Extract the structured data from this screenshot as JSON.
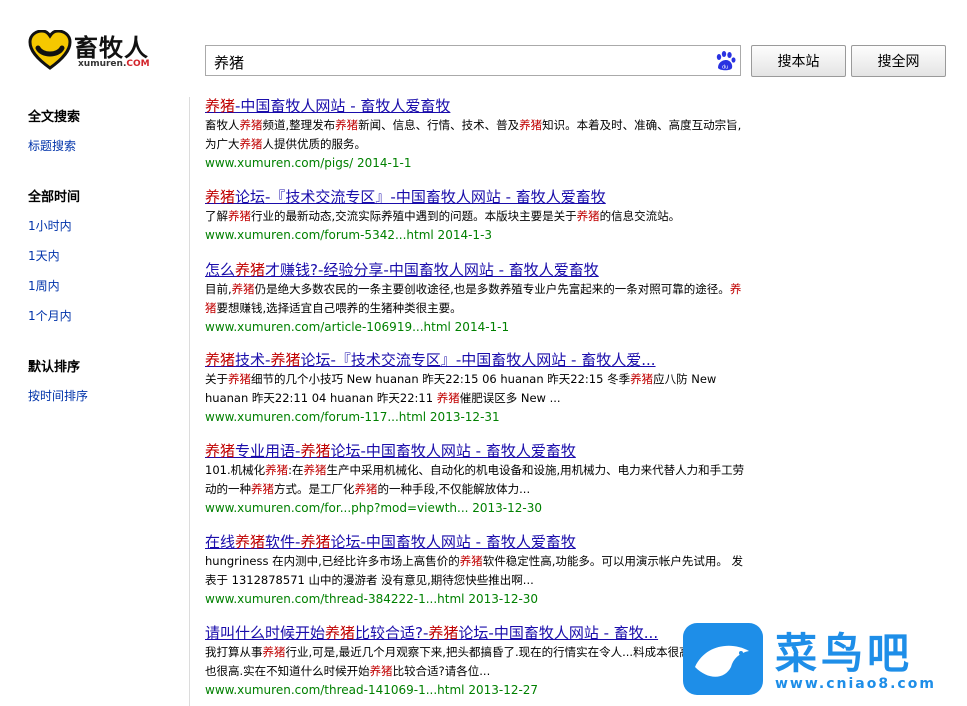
{
  "logo": {
    "name": "畜牧人",
    "sub_main": "xumuren.",
    "sub_com": "COM"
  },
  "search": {
    "query": "养猪",
    "btn_site": "搜本站",
    "btn_all": "搜全网"
  },
  "sidebar": {
    "search_type": {
      "heading": "全文搜索",
      "items": [
        "标题搜索"
      ]
    },
    "time": {
      "heading": "全部时间",
      "items": [
        "1小时内",
        "1天内",
        "1周内",
        "1个月内"
      ]
    },
    "sort": {
      "heading": "默认排序",
      "items": [
        "按时间排序"
      ]
    }
  },
  "results": [
    {
      "title": [
        [
          "养猪",
          true
        ],
        [
          "-中国畜牧人网站 - 畜牧人爱畜牧",
          false
        ]
      ],
      "snippet": [
        [
          "畜牧人",
          false
        ],
        [
          "养猪",
          true
        ],
        [
          "频道,整理发布",
          false
        ],
        [
          "养猪",
          true
        ],
        [
          "新闻、信息、行情、技术、普及",
          false
        ],
        [
          "养猪",
          true
        ],
        [
          "知识。本着及时、准确、高度互动宗旨,为广大",
          false
        ],
        [
          "养猪",
          true
        ],
        [
          "人提供优质的服务。",
          false
        ]
      ],
      "url": "www.xumuren.com/pigs/ 2014-1-1"
    },
    {
      "title": [
        [
          "养猪",
          true
        ],
        [
          "论坛-『技术交流专区』-中国畜牧人网站 - 畜牧人爱畜牧",
          false
        ]
      ],
      "snippet": [
        [
          "了解",
          false
        ],
        [
          "养猪",
          true
        ],
        [
          "行业的最新动态,交流实际养殖中遇到的问题。本版块主要是关于",
          false
        ],
        [
          "养猪",
          true
        ],
        [
          "的信息交流站。",
          false
        ]
      ],
      "url": "www.xumuren.com/forum-5342...html 2014-1-3"
    },
    {
      "title": [
        [
          "怎么",
          false
        ],
        [
          "养猪",
          true
        ],
        [
          "才赚钱?-经验分享-中国畜牧人网站 - 畜牧人爱畜牧",
          false
        ]
      ],
      "snippet": [
        [
          "目前,",
          false
        ],
        [
          "养猪",
          true
        ],
        [
          "仍是绝大多数农民的一条主要创收途径,也是多数养殖专业户先富起来的一条对照可靠的途径。",
          false
        ],
        [
          "养猪",
          true
        ],
        [
          "要想赚钱,选择适宜自己喂养的生猪种类很主要。",
          false
        ]
      ],
      "url": "www.xumuren.com/article-106919...html 2014-1-1"
    },
    {
      "title": [
        [
          "养猪",
          true
        ],
        [
          "技术-",
          false
        ],
        [
          "养猪",
          true
        ],
        [
          "论坛-『技术交流专区』-中国畜牧人网站 - 畜牧人爱...",
          false
        ]
      ],
      "snippet": [
        [
          "关于",
          false
        ],
        [
          "养猪",
          true
        ],
        [
          "细节的几个小技巧 New huanan 昨天22:15 06 huanan 昨天22:15 冬季",
          false
        ],
        [
          "养猪",
          true
        ],
        [
          "应八防 New huanan 昨天22:11 04 huanan 昨天22:11 ",
          false
        ],
        [
          "养猪",
          true
        ],
        [
          "催肥误区多 New ...",
          false
        ]
      ],
      "url": "www.xumuren.com/forum-117...html 2013-12-31"
    },
    {
      "title": [
        [
          "养猪",
          true
        ],
        [
          "专业用语-",
          false
        ],
        [
          "养猪",
          true
        ],
        [
          "论坛-中国畜牧人网站 - 畜牧人爱畜牧",
          false
        ]
      ],
      "snippet": [
        [
          "101.机械化",
          false
        ],
        [
          "养猪",
          true
        ],
        [
          ":在",
          false
        ],
        [
          "养猪",
          true
        ],
        [
          "生产中采用机械化、自动化的机电设备和设施,用机械力、电力来代替人力和手工劳动的一种",
          false
        ],
        [
          "养猪",
          true
        ],
        [
          "方式。是工厂化",
          false
        ],
        [
          "养猪",
          true
        ],
        [
          "的一种手段,不仅能解放体力...",
          false
        ]
      ],
      "url": "www.xumuren.com/for...php?mod=viewth... 2013-12-30"
    },
    {
      "title": [
        [
          "在线",
          false
        ],
        [
          "养猪",
          true
        ],
        [
          "软件-",
          false
        ],
        [
          "养猪",
          true
        ],
        [
          "论坛-中国畜牧人网站 - 畜牧人爱畜牧",
          false
        ]
      ],
      "snippet": [
        [
          "hungriness 在内测中,已经比许多市场上高售价的",
          false
        ],
        [
          "养猪",
          true
        ],
        [
          "软件稳定性高,功能多。可以用演示帐户先试用。 发表于 1312878571 山中的漫游者 没有意见,期待您快些推出啊...",
          false
        ]
      ],
      "url": "www.xumuren.com/thread-384222-1...html 2013-12-30"
    },
    {
      "title": [
        [
          "请叫什么时候开始",
          false
        ],
        [
          "养猪",
          true
        ],
        [
          "比较合适?-",
          false
        ],
        [
          "养猪",
          true
        ],
        [
          "论坛-中国畜牧人网站 - 畜牧...",
          false
        ]
      ],
      "snippet": [
        [
          "我打算从事",
          false
        ],
        [
          "养猪",
          true
        ],
        [
          "行业,可是,最近几个月观察下来,把头都搞昏了.现在的行情实在令人...料成本很高,仔猪价格也很高.实在不知道什么时候开始",
          false
        ],
        [
          "养猪",
          true
        ],
        [
          "比较合适?请各位...",
          false
        ]
      ],
      "url": "www.xumuren.com/thread-141069-1...html 2013-12-27"
    }
  ],
  "watermark": {
    "text": "菜鸟吧",
    "url": "www.cniao8.com"
  },
  "colors": {
    "link": "#1a0dab",
    "highlight": "#c00000",
    "url": "#008000",
    "side_link": "#0033aa",
    "wm": "#1e8ee8"
  }
}
